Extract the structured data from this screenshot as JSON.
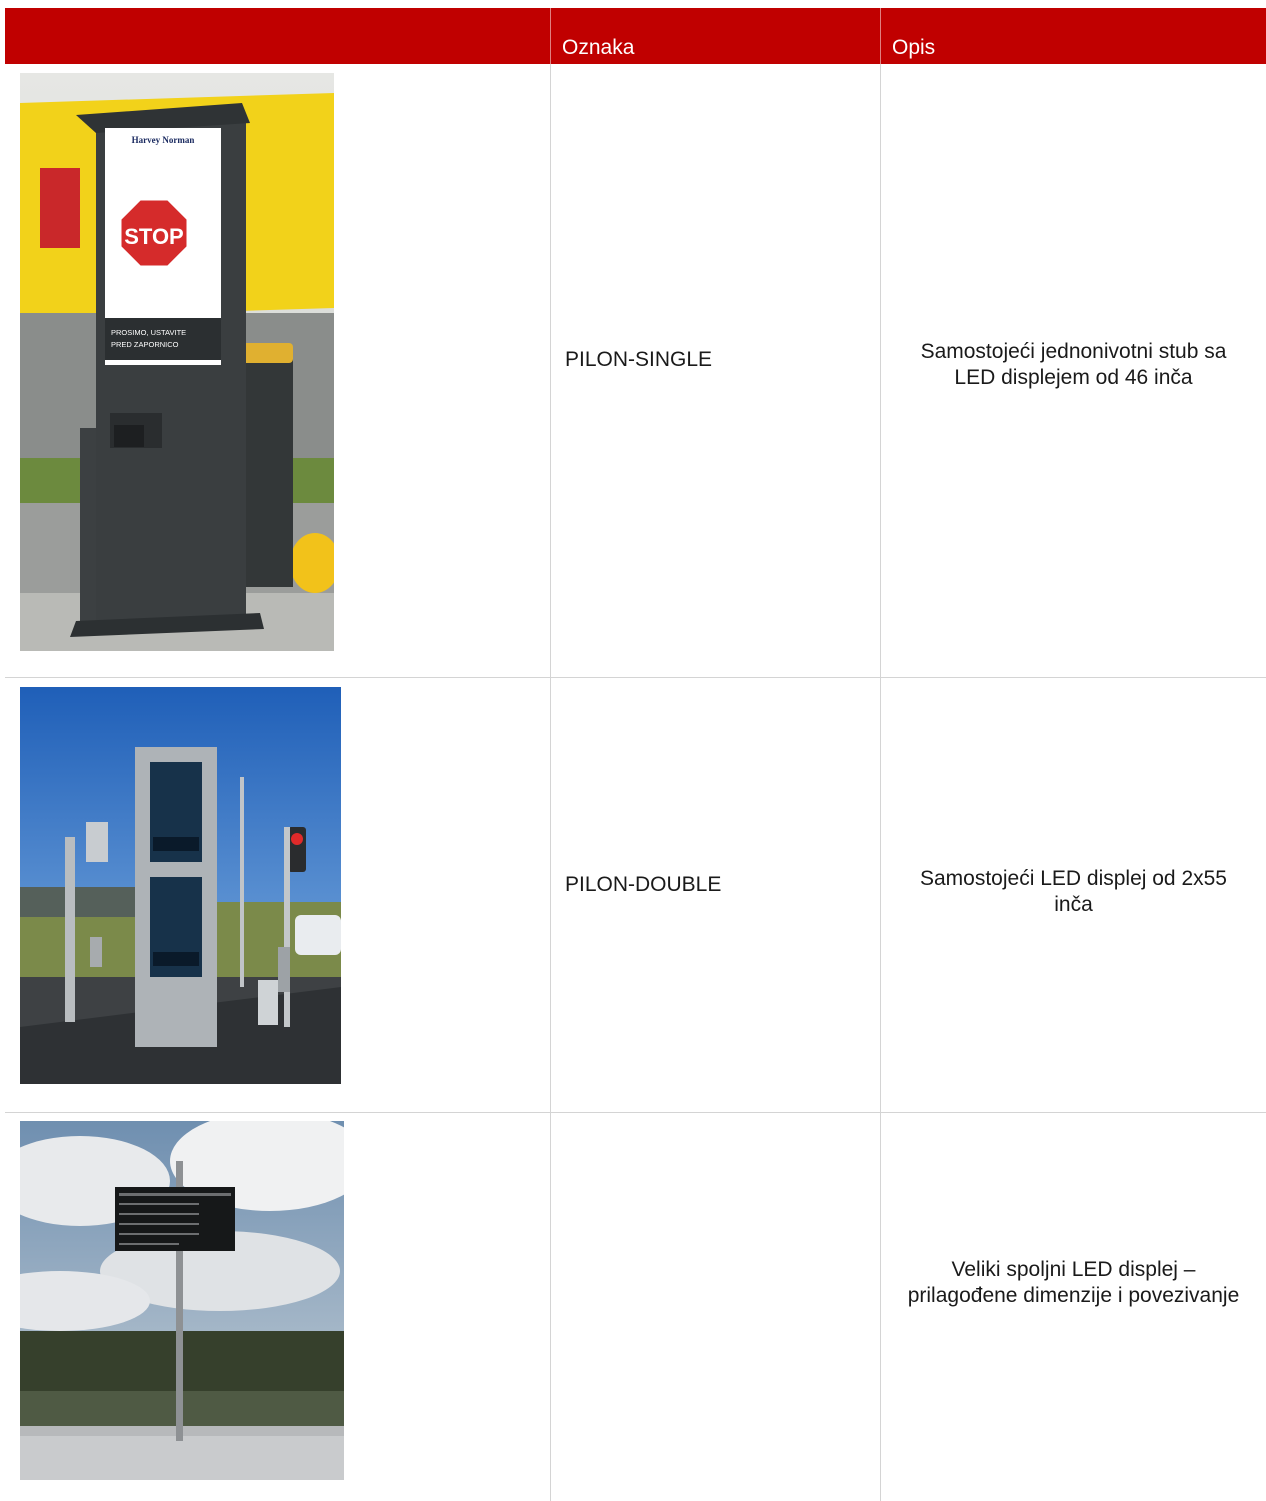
{
  "table": {
    "headers": [
      "",
      "Oznaka",
      "Opis"
    ],
    "rows": [
      {
        "code": "PILON-SINGLE",
        "description": "Samostojeći jednonivotni stub sa LED displejem od 46 inča",
        "photo": {
          "brand": "Harvey Norman",
          "sign": "STOP",
          "notice_line1": "PROSIMO, USTAVITE",
          "notice_line2": "PRED ZAPORNICO"
        }
      },
      {
        "code": "PILON-DOUBLE",
        "description": "Samostojeći LED displej od 2x55 inča"
      },
      {
        "code": "",
        "description": "Veliki spoljni LED displej – prilagođene dimenzije i povezivanje"
      }
    ]
  },
  "colors": {
    "header_bg": "#c00000",
    "header_text": "#ffffff",
    "grid": "#d4d4d4"
  }
}
